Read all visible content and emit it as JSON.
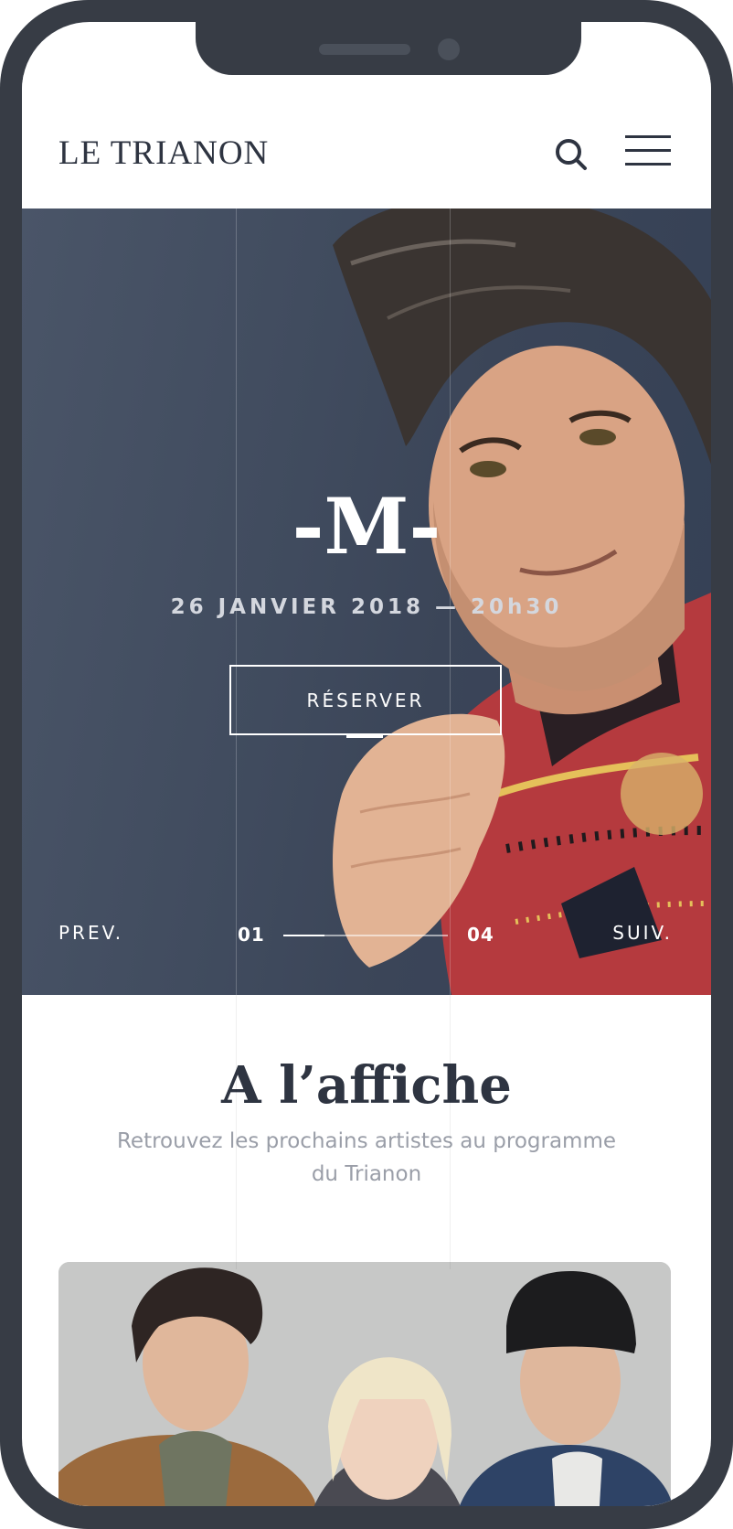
{
  "header": {
    "logo": "LE TRIANON",
    "search_icon": "search-icon",
    "menu_icon": "hamburger-menu-icon"
  },
  "hero": {
    "title": "-M-",
    "date": "26 JANVIER 2018 — 20h30",
    "reserve_label": "RÉSERVER",
    "prev_label": "PREV.",
    "next_label": "SUIV.",
    "current_index": "01",
    "total_index": "04",
    "progress": 0.25
  },
  "section": {
    "title": "A l’affiche",
    "subtitle": "Retrouvez les prochains artistes au programme du Trianon"
  },
  "colors": {
    "frame": "#373c45",
    "text_dark": "#2e3441",
    "text_muted": "#9a9ea8",
    "hero_bg": "#3c4658"
  }
}
